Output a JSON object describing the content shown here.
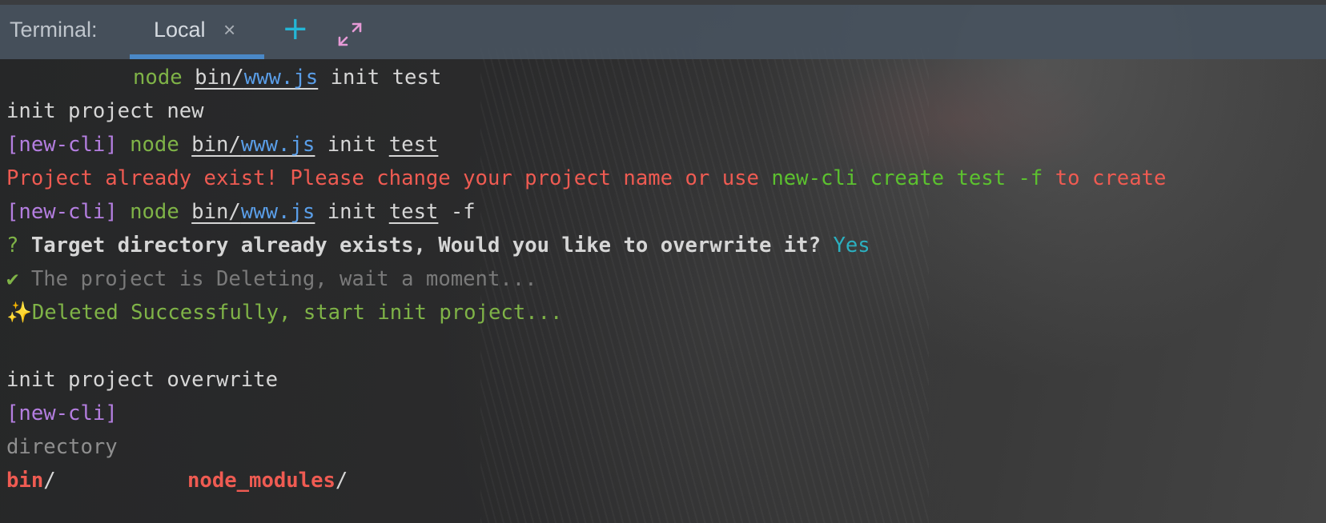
{
  "tabbar": {
    "title": "Terminal:",
    "tab_label": "Local",
    "close_glyph": "×",
    "add_glyph": "+",
    "expand_icon": "expand-icon"
  },
  "colors": {
    "prompt": "#b47ee0",
    "command": "#7fb347",
    "error": "#ef5b52",
    "link": "#5a9ee8",
    "answer": "#2bb0c0",
    "tab_underline": "#4a88c7",
    "add_button": "#24b6d6"
  },
  "terminal": {
    "line1": {
      "cmd": "node",
      "path_prefix": "bin/",
      "path_file": "www.js",
      "args": "init test"
    },
    "line2": {
      "text": "init project new"
    },
    "line3": {
      "prompt": "[new-cli]",
      "cmd": "node",
      "path_prefix": "bin/",
      "path_file": "www.js",
      "arg1": "init",
      "arg2": "test"
    },
    "line4": {
      "error": "Project already exist! Please change your project name or use ",
      "suggestion": "new-cli create test -f",
      "tail": " to create"
    },
    "line5": {
      "prompt": "[new-cli]",
      "cmd": "node",
      "path_prefix": "bin/",
      "path_file": "www.js",
      "arg1": "init",
      "arg2": "test",
      "arg3": "-f"
    },
    "line6": {
      "mark": "?",
      "question": "Target directory already exists, Would you like to overwrite it?",
      "answer": "Yes"
    },
    "line7": {
      "mark": "✔",
      "text": "The project is Deleting, wait a moment..."
    },
    "line8": {
      "mark": "✨",
      "text": "Deleted Successfully, start init project..."
    },
    "line10": {
      "text": "init project overwrite"
    },
    "line11": {
      "prompt": "[new-cli]"
    },
    "line12": {
      "text": "directory"
    },
    "line13": {
      "dir1": "bin",
      "dir2": "node_modules",
      "slash": "/"
    }
  }
}
